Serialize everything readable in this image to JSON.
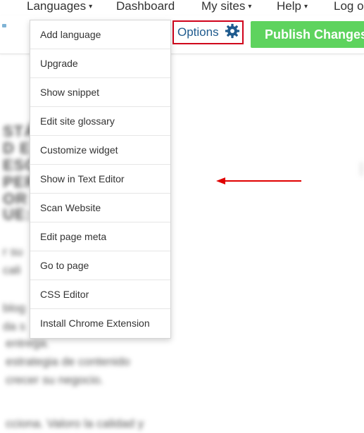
{
  "topnav": {
    "items": [
      {
        "label": "Languages",
        "has_caret": true
      },
      {
        "label": "Dashboard",
        "has_caret": false
      },
      {
        "label": "My sites",
        "has_caret": true
      },
      {
        "label": "Help",
        "has_caret": true
      },
      {
        "label": "Log ou",
        "has_caret": false
      }
    ],
    "caret_glyph": "▾"
  },
  "toolbar": {
    "options_label": "Options",
    "options_icon": "gear-icon",
    "publish_label": "Publish Changes"
  },
  "options_menu": {
    "items": [
      "Add language",
      "Upgrade",
      "Show snippet",
      "Edit site glossary",
      "Customize widget",
      "Show in Text Editor",
      "Scan Website",
      "Edit page meta",
      "Go to page",
      "CSS Editor",
      "Install Chrome Extension"
    ]
  },
  "background_text": {
    "lines": [
      "STÁ",
      "D E",
      "ESCR",
      "PER",
      "OR E",
      "UE:",
      "r su",
      "cali",
      "blog",
      "da s",
      "entrega.",
      "estrategia de contenido",
      "crecer su negocio.",
      "cciona. Valoro la calidad y"
    ]
  },
  "colors": {
    "publish_green": "#5ed35e",
    "options_blue": "#1f5b8e",
    "highlight_red": "#d0021b",
    "arrow_red": "#e00000"
  }
}
